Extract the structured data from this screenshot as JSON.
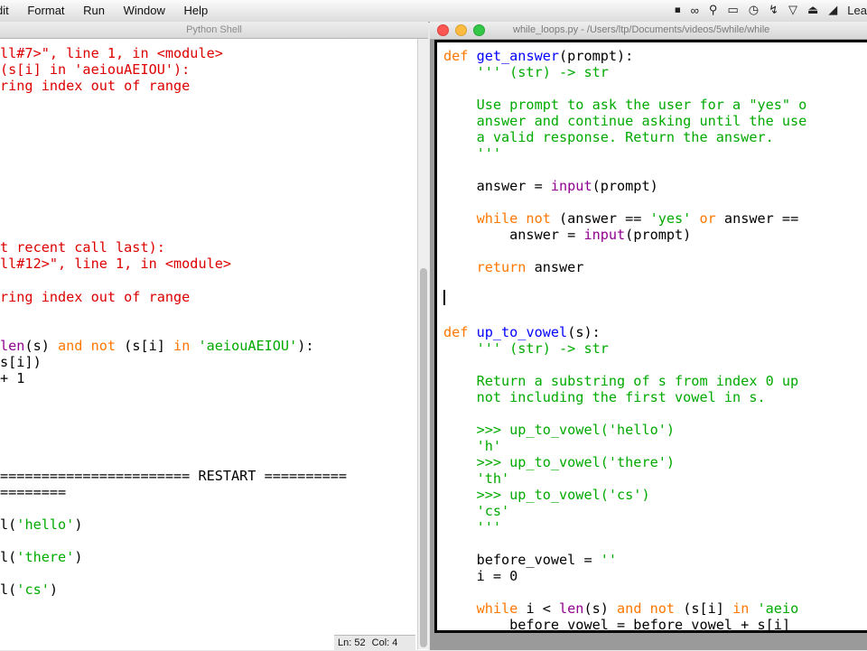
{
  "menubar": {
    "items": [
      "dit",
      "Format",
      "Run",
      "Window",
      "Help"
    ],
    "status_user": "Lea"
  },
  "shell": {
    "title": "Python Shell",
    "status": {
      "line": "Ln: 52",
      "col": "Col: 4"
    },
    "lines": [
      [
        {
          "c": "e",
          "t": "ll#7>\", line 1, in <module>"
        }
      ],
      [
        {
          "c": "e",
          "t": "(s[i] in 'aeiouAEIOU'):"
        }
      ],
      [
        {
          "c": "e",
          "t": "ring index out of range"
        }
      ],
      [
        {
          "c": "e",
          "t": "t recent call last):"
        }
      ],
      [
        {
          "c": "e",
          "t": "ll#12>\", line 1, in <module>"
        }
      ],
      [
        {
          "c": "e",
          "t": "ring index out of range"
        }
      ],
      [
        {
          "c": "b",
          "t": "len"
        },
        {
          "c": "n",
          "t": "(s) "
        },
        {
          "c": "k",
          "t": "and not"
        },
        {
          "c": "n",
          "t": " (s[i] "
        },
        {
          "c": "k",
          "t": "in"
        },
        {
          "c": "n",
          "t": " "
        },
        {
          "c": "s",
          "t": "'aeiouAEIOU'"
        },
        {
          "c": "n",
          "t": "):"
        }
      ],
      [
        {
          "c": "n",
          "t": "s[i])"
        }
      ],
      [
        {
          "c": "n",
          "t": "+ 1"
        }
      ],
      [
        {
          "c": "n",
          "t": "======================= RESTART =========="
        }
      ],
      [
        {
          "c": "n",
          "t": "========"
        }
      ],
      [
        {
          "c": "n",
          "t": "l("
        },
        {
          "c": "s",
          "t": "'hello'"
        },
        {
          "c": "n",
          "t": ")"
        }
      ],
      [
        {
          "c": "n",
          "t": "l("
        },
        {
          "c": "s",
          "t": "'there'"
        },
        {
          "c": "n",
          "t": ")"
        }
      ],
      [
        {
          "c": "n",
          "t": "l("
        },
        {
          "c": "s",
          "t": "'cs'"
        },
        {
          "c": "n",
          "t": ")"
        }
      ]
    ]
  },
  "editor": {
    "title": "while_loops.py - /Users/ltp/Documents/videos/5while/while",
    "lines": [
      [
        {
          "c": "k",
          "t": "def"
        },
        {
          "c": "n",
          "t": " "
        },
        {
          "c": "f",
          "t": "get_answer"
        },
        {
          "c": "n",
          "t": "(prompt):"
        }
      ],
      [
        {
          "c": "s",
          "t": "    ''' (str) -> str"
        }
      ],
      [
        {
          "c": "s",
          "t": "    Use prompt to ask the user for a \"yes\" o"
        }
      ],
      [
        {
          "c": "s",
          "t": "    answer and continue asking until the use"
        }
      ],
      [
        {
          "c": "s",
          "t": "    a valid response. Return the answer."
        }
      ],
      [
        {
          "c": "s",
          "t": "    '''"
        }
      ],
      [
        {
          "c": "n",
          "t": "    answer = "
        },
        {
          "c": "b",
          "t": "input"
        },
        {
          "c": "n",
          "t": "(prompt)"
        }
      ],
      [
        {
          "c": "k",
          "t": "    while not"
        },
        {
          "c": "n",
          "t": " (answer == "
        },
        {
          "c": "s",
          "t": "'yes'"
        },
        {
          "c": "n",
          "t": " "
        },
        {
          "c": "k",
          "t": "or"
        },
        {
          "c": "n",
          "t": " answer =="
        }
      ],
      [
        {
          "c": "n",
          "t": "        answer = "
        },
        {
          "c": "b",
          "t": "input"
        },
        {
          "c": "n",
          "t": "(prompt)"
        }
      ],
      [
        {
          "c": "k",
          "t": "    return"
        },
        {
          "c": "n",
          "t": " answer"
        }
      ],
      [
        {
          "c": "k",
          "t": "def"
        },
        {
          "c": "n",
          "t": " "
        },
        {
          "c": "f",
          "t": "up_to_vowel"
        },
        {
          "c": "n",
          "t": "(s):"
        }
      ],
      [
        {
          "c": "s",
          "t": "    ''' (str) -> str"
        }
      ],
      [
        {
          "c": "s",
          "t": "    Return a substring of s from index 0 up"
        }
      ],
      [
        {
          "c": "s",
          "t": "    not including the first vowel in s."
        }
      ],
      [
        {
          "c": "s",
          "t": "    >>> up_to_vowel('hello')"
        }
      ],
      [
        {
          "c": "s",
          "t": "    'h'"
        }
      ],
      [
        {
          "c": "s",
          "t": "    >>> up_to_vowel('there')"
        }
      ],
      [
        {
          "c": "s",
          "t": "    'th'"
        }
      ],
      [
        {
          "c": "s",
          "t": "    >>> up_to_vowel('cs')"
        }
      ],
      [
        {
          "c": "s",
          "t": "    'cs'"
        }
      ],
      [
        {
          "c": "s",
          "t": "    '''"
        }
      ],
      [
        {
          "c": "n",
          "t": "    before_vowel = "
        },
        {
          "c": "s",
          "t": "''"
        }
      ],
      [
        {
          "c": "n",
          "t": "    i = 0"
        }
      ],
      [
        {
          "c": "k",
          "t": "    while"
        },
        {
          "c": "n",
          "t": " i < "
        },
        {
          "c": "b",
          "t": "len"
        },
        {
          "c": "n",
          "t": "(s) "
        },
        {
          "c": "k",
          "t": "and not"
        },
        {
          "c": "n",
          "t": " (s[i] "
        },
        {
          "c": "k",
          "t": "in"
        },
        {
          "c": "n",
          "t": " "
        },
        {
          "c": "s",
          "t": "'aeio"
        }
      ],
      [
        {
          "c": "n",
          "t": "        before_vowel = before_vowel + s[i]"
        }
      ]
    ]
  }
}
